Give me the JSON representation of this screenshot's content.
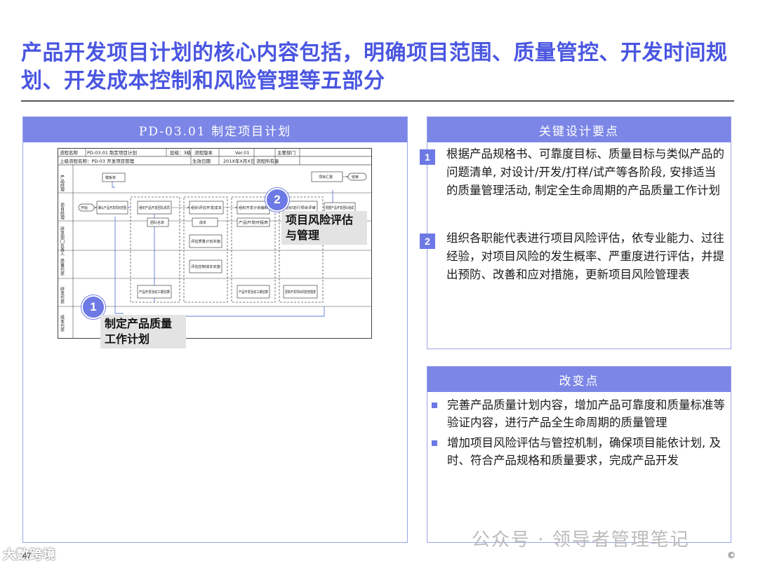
{
  "title": "产品开发项目计划的核心内容包括，明确项目范围、质量管控、开发时间规划、开发成本控制和风险管理等五部分",
  "left_panel": {
    "header": "PD-03.01 制定项目计划",
    "flowchart": {
      "row1": [
        "流程名称",
        "PD-03.01 制定项目计划",
        "层级：3级",
        "流程版本",
        "Ver.01",
        "主要部门"
      ],
      "row2": [
        "上级流程名称：PD-03 开发项目管理",
        "生效日期",
        "201X年X月X日",
        "流程所有者"
      ],
      "lanes": [
        "产品经理",
        "项目经理",
        "研发部门负责人",
        "质量代表",
        "研发代表",
        "成本代表"
      ],
      "boxes": {
        "b_start": "开始",
        "b_report": "模板单",
        "b_confirm": "确认产品开发项目范围",
        "b_team": "组织产品开发团队成员",
        "b_list": "团队名单",
        "b_eval": "组织评估开发成本",
        "b_cost": "成本",
        "b_quality": "评估质量计划实施",
        "b_cost2": "评估控制成本实施",
        "b_plan": "组织开发计划编制",
        "b_plan2": "产品开发时程表",
        "b_review": "组织进行项目评审",
        "b_approve": "项目汇报",
        "b_end": "结束",
        "b_team2": "根据产品开发团队组成",
        "b_dev": "产品开发活动工期估算",
        "b_risk": "更新开发项目风险管理表"
      }
    },
    "callout1": {
      "num": "1",
      "label": "制定产品质量工作计划"
    },
    "callout2": {
      "num": "2",
      "label": "项目风险评估与管理"
    }
  },
  "points_panel": {
    "header": "关键设计要点",
    "items": [
      {
        "num": "1",
        "text": "根据产品规格书、可靠度目标、质量目标与类似产品的问题清单, 对设计/开发/打样/试产等各阶段, 安排适当的质量管理活动, 制定全生命周期的产品质量工作计划"
      },
      {
        "num": "2",
        "text": "组织各职能代表进行项目风险评估，依专业能力、过往经验，对项目风险的发生概率、严重度进行评估，并提出预防、改善和应对措施，更新项目风险管理表"
      }
    ]
  },
  "changes_panel": {
    "header": "改变点",
    "items": [
      "完善产品质量计划内容，增加产品可靠度和质量标准等验证内容，进行产品全生命周期的质量管理",
      "增加项目风险评估与管控机制，确保项目能依计划, 及时、符合产品规格和质量要求，完成产品开发"
    ]
  },
  "footer": {
    "page_number": "47",
    "logo_text": "大数跨境",
    "watermark": "公众号 · 领导者管理笔记",
    "copyright": "©"
  },
  "colors": {
    "accent": "#4a56e0",
    "header_bg": "#7b86e6",
    "badge": "#6d79e4"
  }
}
